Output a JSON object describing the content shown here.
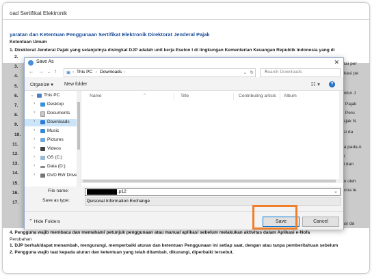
{
  "doc": {
    "title": "oad Sertifikat Elektronik",
    "heading": "yaratan dan Ketentuan Penggunaan Sertifikat Elektronik Direktorat Jenderal Pajak",
    "subheading": "Ketentuan Umum",
    "line1": "1. Direktorat Jenderal Pajak yang selanjutnya disingkat DJP adalah unit kerja Eselon I di lingkungan Kementerian Keuangan Republik Indonesia yang di",
    "left_frags": [
      "2.",
      "3.",
      "4.",
      "5.",
      "6.",
      "7.",
      "8.",
      "9.",
      "10.",
      "11.",
      "12.",
      "13.",
      "14.",
      "15.",
      "16.",
      "17."
    ],
    "right_frags": [
      "plikasi per",
      "Aplikasi pe",
      "Direktur J",
      "dan Pajak",
      "nan Peru",
      "n Pajak N",
      "tivasi da",
      "unya pada A",
      "DJP.",
      "tujui dan",
      "ukan oleh",
      "ngguna te",
      "nikasi da"
    ],
    "bottom_lines": [
      "4. Pengguna wajib membaca dan memahami petunjuk penggunaan atau manual aplikasi sebelum melakukan aktivitas dalam Aplikasi e-Nofa",
      "Perubahan",
      "1. DJP berhak/dapat menambah, mengurangi, memperbaiki aturan dan ketentuan Penggunaan ini setiap saat, dengan atau tanpa pemberitahuan sebelum",
      "2. Pengguna wajib taat kepada aturan dan ketentuan yang telah ditambah, dikurangi, diperbaiki tersebut."
    ]
  },
  "dialog": {
    "title": "Save As",
    "close_glyph": "✕",
    "breadcrumb": [
      "This PC",
      "Downloads"
    ],
    "search_placeholder": "Search Downloads",
    "toolbar": {
      "organize": "Organize ▾",
      "new_folder": "New folder",
      "help": "?"
    },
    "tree": [
      {
        "label": "This PC",
        "icon": "computer-icon",
        "expanded": true
      },
      {
        "label": "Desktop",
        "icon": "folder-icon"
      },
      {
        "label": "Documents",
        "icon": "documents-icon"
      },
      {
        "label": "Downloads",
        "icon": "download-icon",
        "selected": true
      },
      {
        "label": "Music",
        "icon": "music-icon"
      },
      {
        "label": "Pictures",
        "icon": "pictures-icon"
      },
      {
        "label": "Videos",
        "icon": "videos-icon"
      },
      {
        "label": "OS (C:)",
        "icon": "drive-icon"
      },
      {
        "label": "Data (D:)",
        "icon": "drive-icon"
      },
      {
        "label": "DVD RW Drive",
        "icon": "dvd-icon"
      }
    ],
    "columns": [
      "Name",
      "Title",
      "Contributing artists",
      "Album"
    ],
    "file_name_label": "File name:",
    "file_name_suffix": ".p12",
    "save_type_label": "Save as type:",
    "save_type_value": "Personal Information Exchange",
    "hide_folders": "Hide Folders",
    "save_button": "Save",
    "cancel_button": "Cancel"
  },
  "colors": {
    "highlight": "#f07f2b",
    "selected_row": "#cce4f7",
    "accent": "#1f6fc5"
  }
}
